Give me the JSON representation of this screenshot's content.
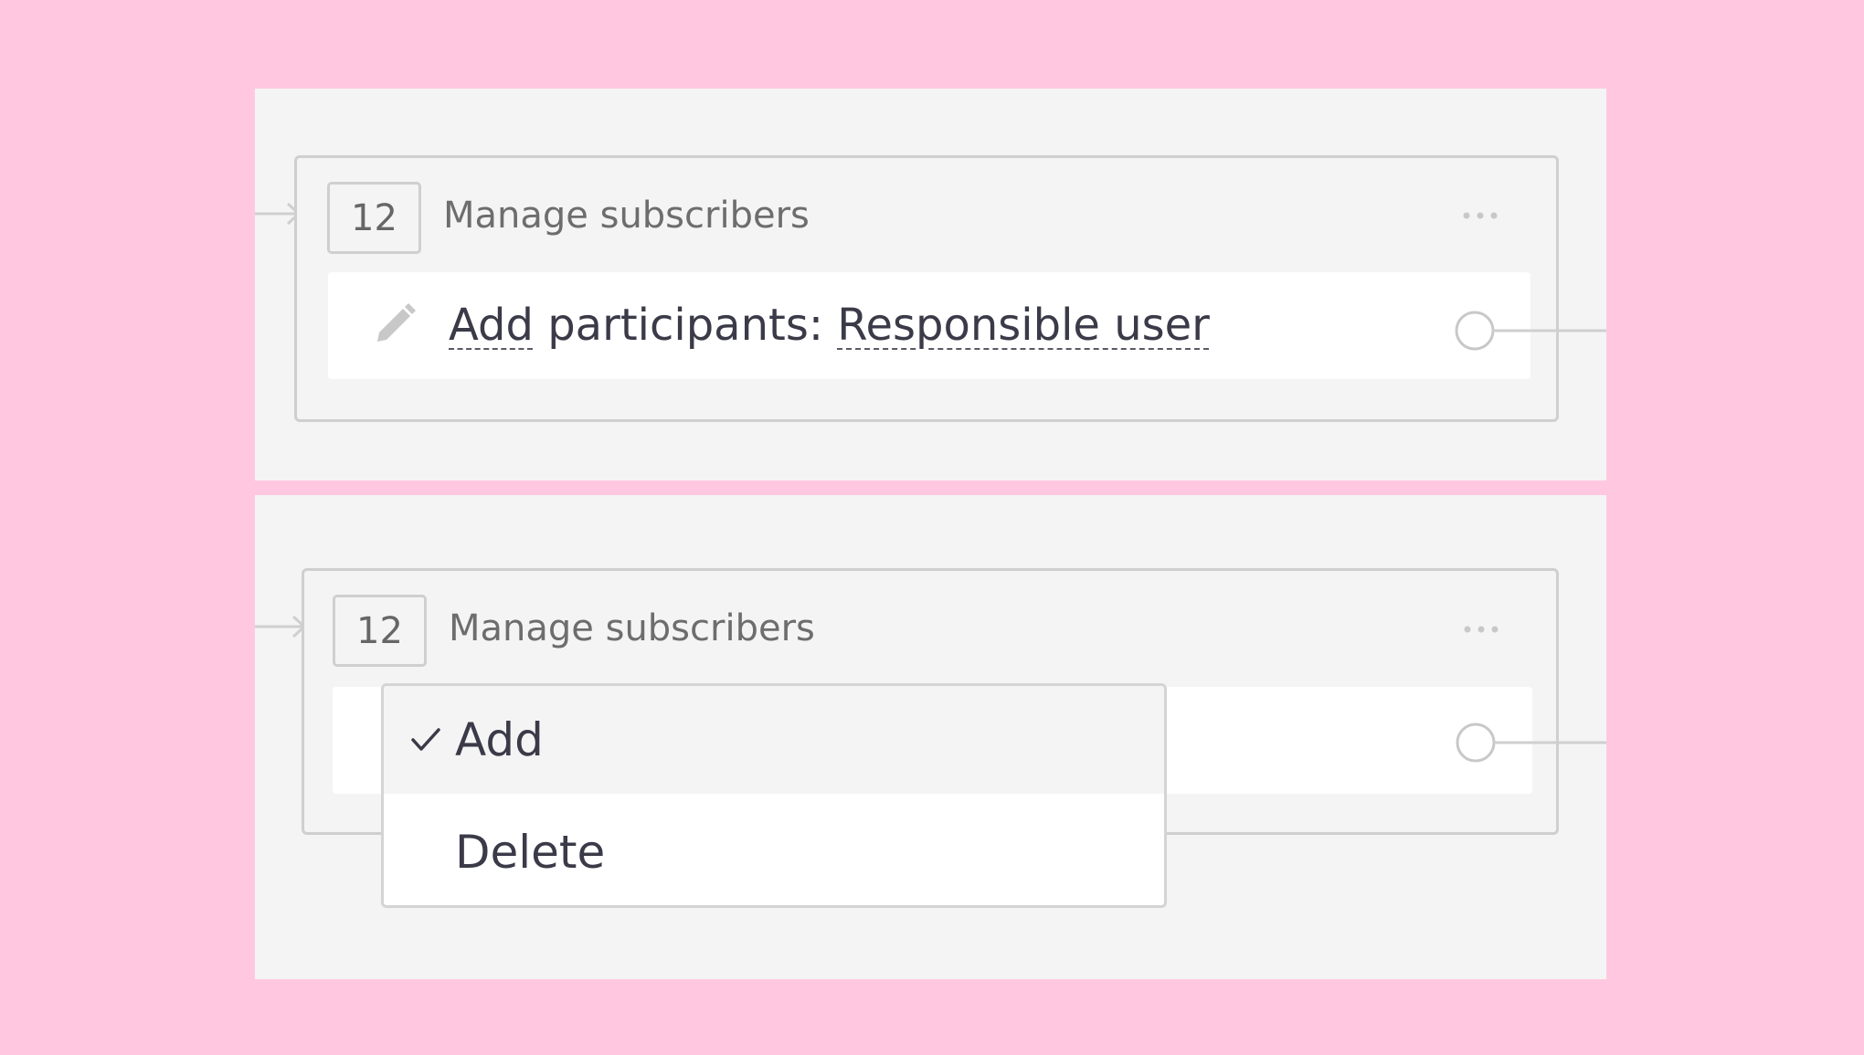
{
  "nodes": [
    {
      "number": "12",
      "title": "Manage subscribers",
      "action": {
        "verb": "Add",
        "middle": " participants: ",
        "target": "Responsible user"
      }
    },
    {
      "number": "12",
      "title": "Manage subscribers"
    }
  ],
  "dropdown": {
    "options": [
      {
        "label": "Add",
        "selected": true
      },
      {
        "label": "Delete",
        "selected": false
      }
    ]
  },
  "colors": {
    "background": "#ffc8e0",
    "panel": "#f4f4f4",
    "border": "#cfcfcf",
    "text": "#3a3a48"
  }
}
